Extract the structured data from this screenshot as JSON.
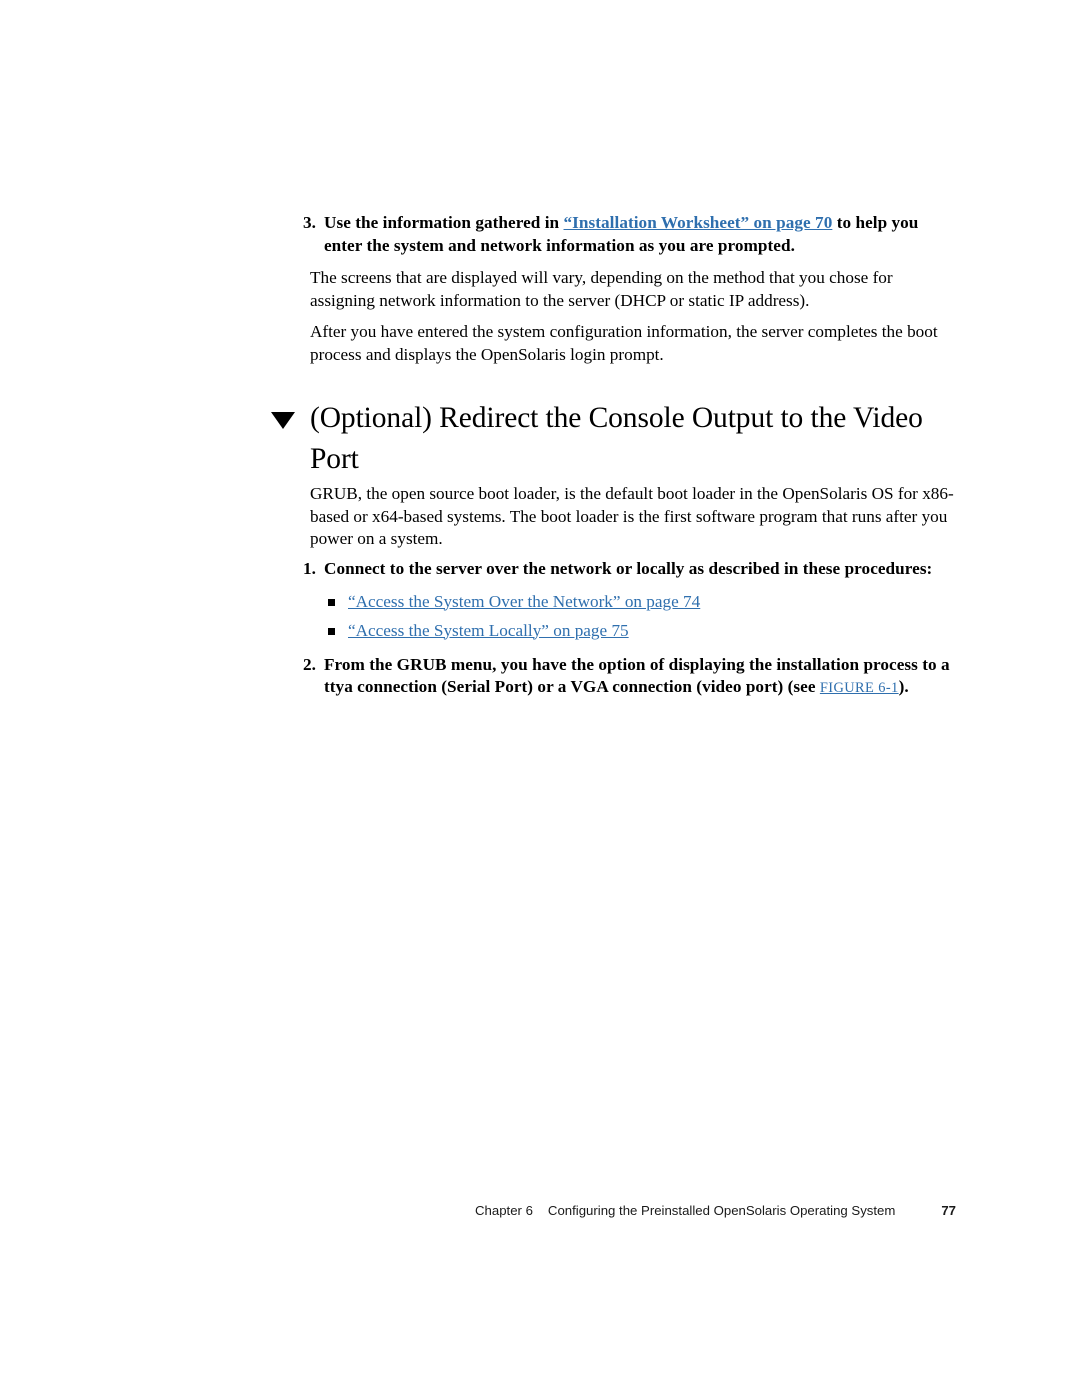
{
  "colors": {
    "link": "#2f6fae",
    "text": "#000000",
    "background": "#ffffff"
  },
  "step3": {
    "number": "3.",
    "lead_bold_before": "Use the information gathered in ",
    "link_text": "“Installation Worksheet” on page 70",
    "bold_after": " to help you enter the system and network information as you are prompted.",
    "paragraph1": "The screens that are displayed will vary, depending on the method that you chose for assigning network information to the server (DHCP or static IP address).",
    "paragraph2": "After you have entered the system configuration information, the server completes the boot process and displays the OpenSolaris login prompt."
  },
  "section": {
    "marker": "triangle-down-icon",
    "heading": "(Optional) Redirect the Console Output to the Video Port",
    "lead_paragraph": "GRUB, the open source boot loader, is the default boot loader in the OpenSolaris OS for x86-based or x64-based systems. The boot loader is the first software program that runs after you power on a system."
  },
  "procedure": {
    "step1": {
      "number": "1.",
      "text": "Connect to the server over the network or locally as described in these procedures:",
      "links": [
        "“Access the System Over the Network” on page 74",
        "“Access the System Locally” on page 75"
      ]
    },
    "step2": {
      "number": "2.",
      "text_before": "From the GRUB menu, you have the option of displaying the installation process to a ttya connection (Serial Port) or a VGA connection (video port) (see ",
      "figure_ref": "FIGURE 6-1",
      "text_after": ")."
    }
  },
  "footer": {
    "chapter": "Chapter 6",
    "title": "Configuring the Preinstalled OpenSolaris Operating System",
    "page_number": "77"
  }
}
